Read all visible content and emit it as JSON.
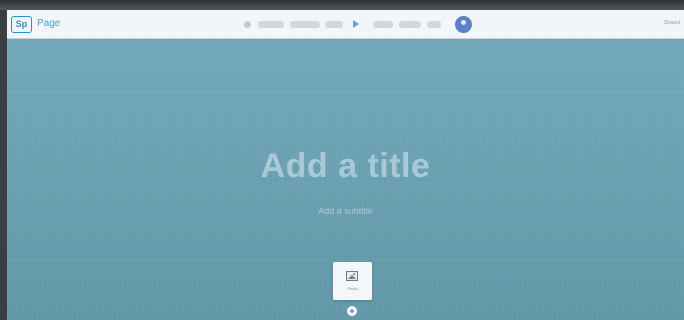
{
  "app": {
    "logo_text": "Sp",
    "name": "Page",
    "share_label": "Shared"
  },
  "toolbar": {
    "icons": [
      "dot-icon",
      "dash-icon",
      "dash-icon",
      "dash-icon",
      "play-icon",
      "dash-icon",
      "dash-icon"
    ],
    "accent_color": "#2a8fc9"
  },
  "hero": {
    "title": "Add a title",
    "subtitle": "Add a subtitle",
    "background_color": "#6ba5b7"
  },
  "image_card": {
    "label": "Photo",
    "icon": "image-icon"
  },
  "add_section": {
    "label": "+"
  }
}
